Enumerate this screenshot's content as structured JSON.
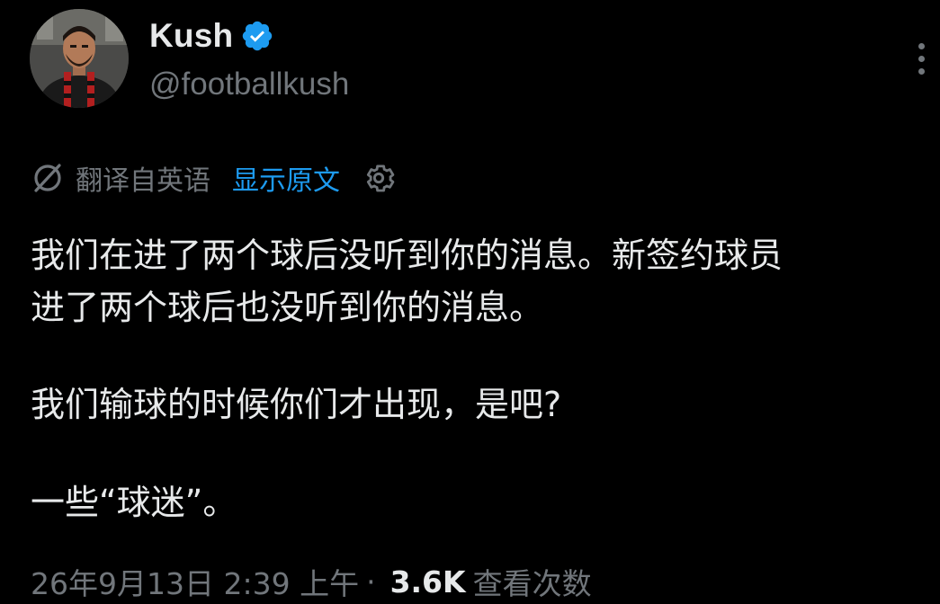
{
  "author": {
    "display_name": "Kush",
    "handle": "@footballkush",
    "avatar": "avatar-photo",
    "verified_icon": "verified-badge-icon"
  },
  "more_icon": "more-options-icon",
  "translation": {
    "icon": "translate-icon",
    "label": "翻译自英语",
    "show_original": "显示原文",
    "settings_icon": "gear-icon"
  },
  "tweet": {
    "line1": "我们在进了两个球后没听到你的消息。新签约球员",
    "line2": "进了两个球后也没听到你的消息。",
    "line3": "我们输球的时候你们才出现，是吧?",
    "line4": "一些“球迷”。"
  },
  "meta": {
    "timestamp": "26年9月13日 2:39 上午",
    "separator": "·",
    "views_count": "3.6K",
    "views_label": "查看次数"
  },
  "colors": {
    "background": "#000000",
    "text": "#e7e9ea",
    "secondary": "#71767b",
    "link": "#1d9bf0",
    "verified": "#1d9bf0"
  }
}
